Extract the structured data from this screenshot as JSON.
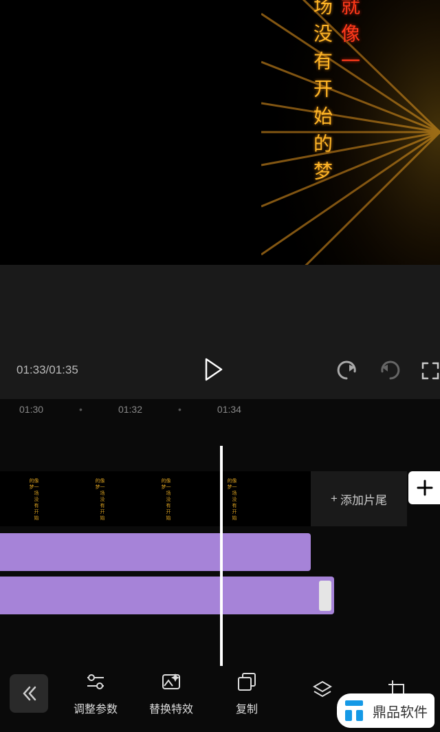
{
  "preview": {
    "text_line1": "就像一",
    "text_line2": "场没有开始的梦"
  },
  "playback": {
    "current": "01:33",
    "total": "01:35",
    "display": "01:33/01:35"
  },
  "ruler": {
    "t0": "01:30",
    "t1": "01:32",
    "t2": "01:34"
  },
  "timeline": {
    "add_tail": "添加片尾",
    "thumb_text": "像一场没有开始的梦"
  },
  "toolbar": {
    "adjust": "调整参数",
    "replace_fx": "替换特效",
    "copy": "复制"
  },
  "watermark": {
    "brand": "鼎品软件"
  }
}
